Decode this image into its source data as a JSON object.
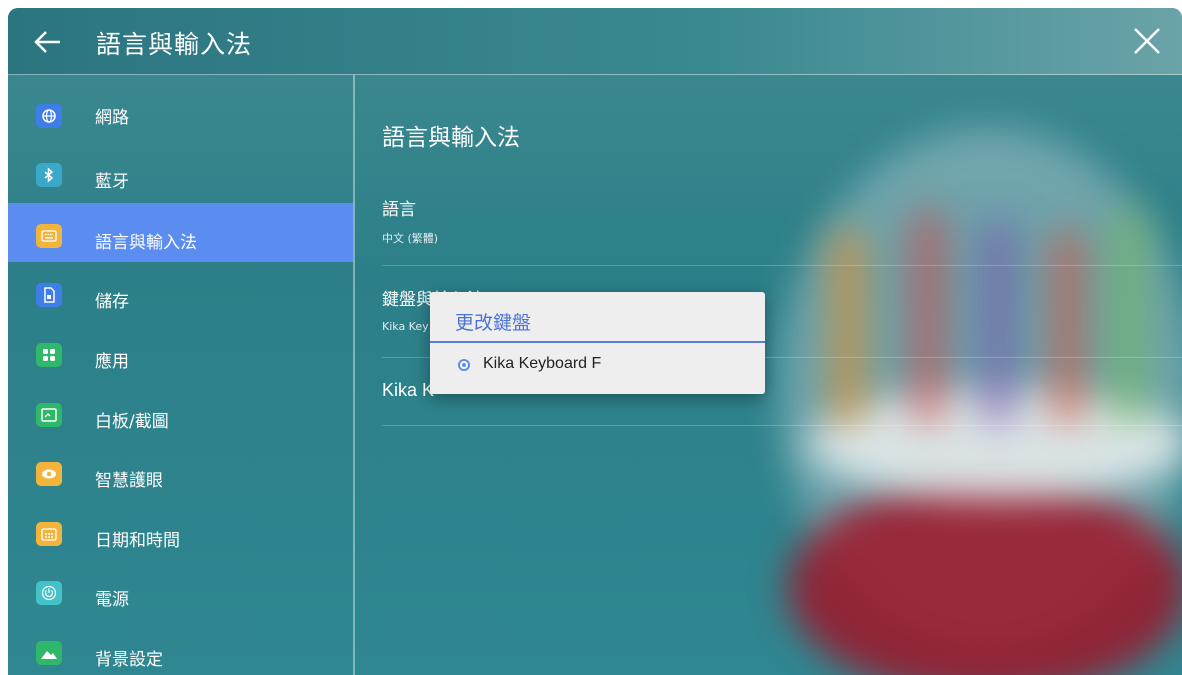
{
  "header": {
    "title": "語言與輸入法"
  },
  "sidebar": {
    "items": [
      {
        "label": "網路",
        "icon": "globe-icon",
        "color": "#3f7ee8"
      },
      {
        "label": "藍牙",
        "icon": "bluetooth-icon",
        "color": "#3aa8c8"
      },
      {
        "label": "語言與輸入法",
        "icon": "keyboard-icon",
        "color": "#f2b43a",
        "active": true
      },
      {
        "label": "儲存",
        "icon": "storage-icon",
        "color": "#3f7ee8"
      },
      {
        "label": "應用",
        "icon": "apps-icon",
        "color": "#2fb86a"
      },
      {
        "label": "白板/截圖",
        "icon": "whiteboard-icon",
        "color": "#2fb86a"
      },
      {
        "label": "智慧護眼",
        "icon": "eye-icon",
        "color": "#f2b43a"
      },
      {
        "label": "日期和時間",
        "icon": "calendar-icon",
        "color": "#f2b43a"
      },
      {
        "label": "電源",
        "icon": "power-icon",
        "color": "#44c2c7"
      },
      {
        "label": "背景設定",
        "icon": "wallpaper-icon",
        "color": "#2fb86a"
      }
    ]
  },
  "content": {
    "title": "語言與輸入法",
    "settings": [
      {
        "title": "語言",
        "subtitle": "中文 (繁體)"
      },
      {
        "title": "鍵盤與輸入法",
        "subtitle": "Kika Key"
      },
      {
        "title": "Kika K",
        "subtitle": ""
      }
    ]
  },
  "dialog": {
    "title": "更改鍵盤",
    "options": [
      {
        "label": "Kika Keyboard F",
        "selected": true
      }
    ]
  },
  "colors": {
    "accent": "#5b8cf0",
    "dialog_title": "#4b73d6"
  }
}
